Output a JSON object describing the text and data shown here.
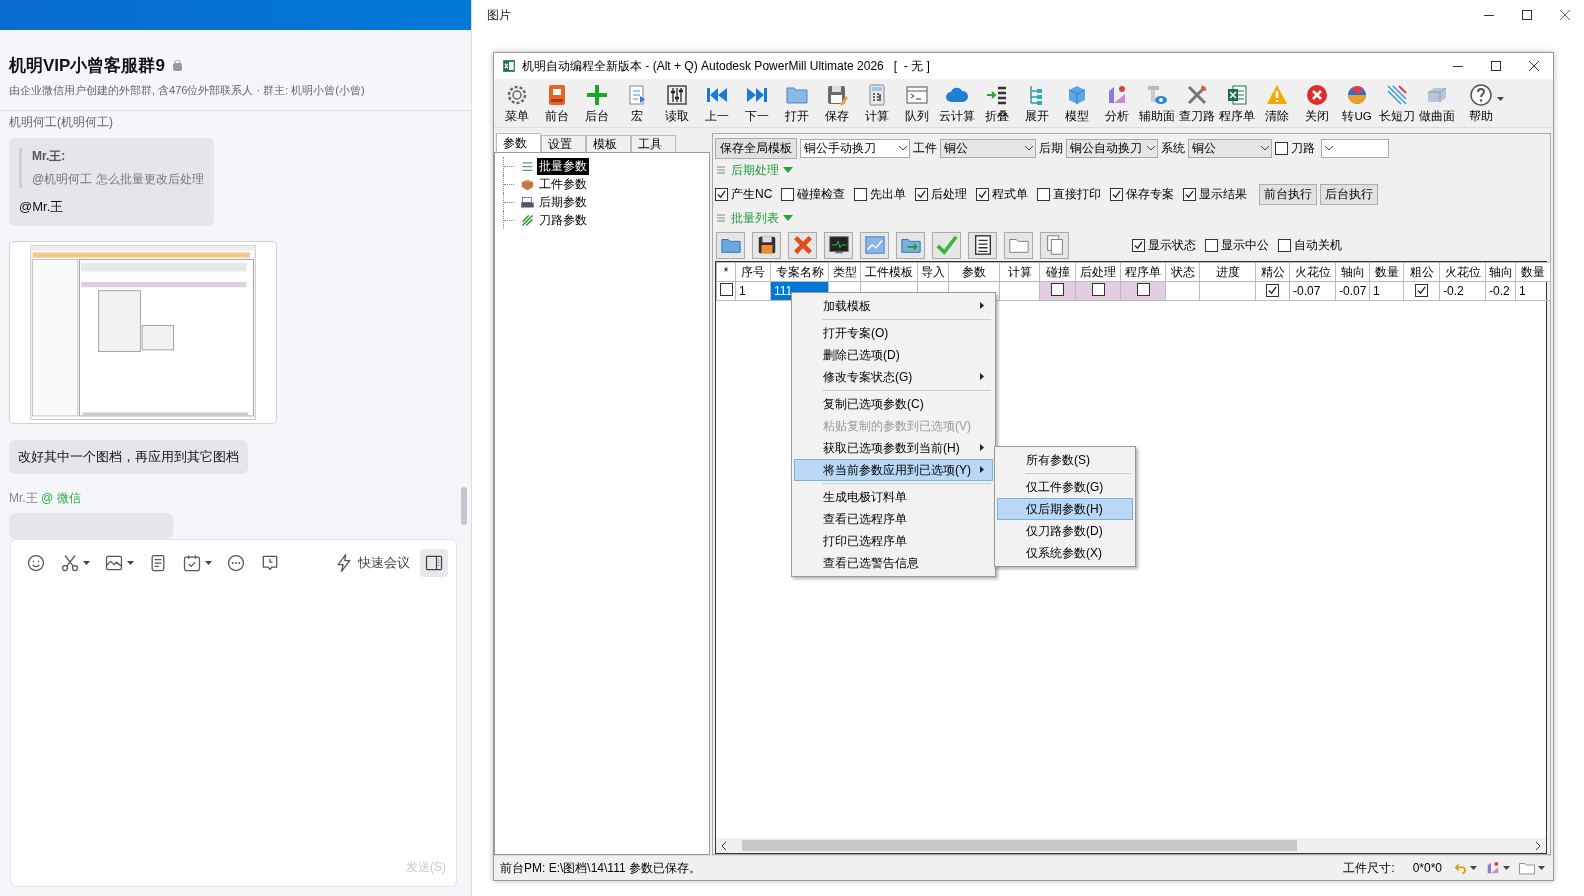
{
  "chat": {
    "title": "机明VIP小曾客服群9",
    "subtitle": "由企业微信用户创建的外部群, 含476位外部联系人 · 群主: 机明小曾(小曾)",
    "sender": "机明何工(机明何工)",
    "quote_author": "Mr.王:",
    "quote_text": "@机明何工 怎么批量更改后处理",
    "reply": "@Mr.王",
    "message": "改好其中一个图档，再应用到其它图档",
    "next_sender": "Mr.王",
    "next_source": "@ 微信",
    "meeting": "快速会议",
    "send": "发送(S)"
  },
  "viewer": {
    "title": "图片"
  },
  "app": {
    "title": "机明自动编程全新版本 - (Alt + Q) Autodesk PowerMill Ultimate 2026   [  - 无 ]",
    "toolbar": [
      "菜单",
      "前台",
      "后台",
      "宏",
      "读取",
      "上一",
      "下一",
      "打开",
      "保存",
      "计算",
      "队列",
      "云计算",
      "折叠",
      "展开",
      "模型",
      "分析",
      "辅助面",
      "查刀路",
      "程序单",
      "清除",
      "关闭",
      "转UG",
      "长短刀",
      "做曲面",
      "帮助"
    ],
    "tabs": [
      {
        "label": "参数",
        "selected": true
      },
      {
        "label": "设置",
        "selected": false
      },
      {
        "label": "模板",
        "selected": false
      },
      {
        "label": "工具",
        "selected": false
      }
    ],
    "tree": [
      {
        "label": "批量参数",
        "selected": true
      },
      {
        "label": "工件参数",
        "selected": false
      },
      {
        "label": "后期参数",
        "selected": false
      },
      {
        "label": "刀路参数",
        "selected": false
      }
    ],
    "save_template": "保存全局模板",
    "template": "铜公手动换刀",
    "work_label": "工件",
    "work": "铜公",
    "post_label": "后期",
    "post": "铜公自动换刀",
    "system_label": "系统",
    "system": "铜公",
    "toolpath": {
      "label": "刀路",
      "checked": false
    },
    "post_section": "后期处理",
    "post_options": [
      {
        "label": "产生NC",
        "checked": true
      },
      {
        "label": "碰撞检查",
        "checked": false
      },
      {
        "label": "先出单",
        "checked": false
      },
      {
        "label": "后处理",
        "checked": true
      },
      {
        "label": "程式单",
        "checked": true
      },
      {
        "label": "直接打印",
        "checked": false
      },
      {
        "label": "保存专案",
        "checked": true
      },
      {
        "label": "显示结果",
        "checked": true
      }
    ],
    "run_buttons": [
      "前台执行",
      "后台执行"
    ],
    "batch_section": "批量列表",
    "view_options": [
      {
        "label": "显示状态",
        "checked": true
      },
      {
        "label": "显示中公",
        "checked": false
      },
      {
        "label": "自动关机",
        "checked": false
      }
    ],
    "table": {
      "columns": [
        "*",
        "序号",
        "专案名称",
        "类型",
        "工件模板",
        "导入",
        "参数",
        "计算",
        "碰撞",
        "后处理",
        "程序单",
        "状态",
        "进度",
        "精公",
        "火花位",
        "轴向",
        "数量",
        "粗公",
        "火花位",
        "轴向",
        "数量"
      ],
      "rows": [
        {
          "cells": [
            {
              "kind": "check",
              "checked": false
            },
            {
              "kind": "text",
              "text": "1"
            },
            {
              "kind": "text",
              "text": "111",
              "selected": true
            },
            {
              "kind": "empty"
            },
            {
              "kind": "empty"
            },
            {
              "kind": "empty"
            },
            {
              "kind": "empty"
            },
            {
              "kind": "empty"
            },
            {
              "kind": "check",
              "checked": false,
              "highlight": true
            },
            {
              "kind": "check",
              "checked": false,
              "highlight": true
            },
            {
              "kind": "check",
              "checked": false,
              "highlight": true
            },
            {
              "kind": "empty"
            },
            {
              "kind": "empty"
            },
            {
              "kind": "check",
              "checked": true
            },
            {
              "kind": "text",
              "text": "-0.07"
            },
            {
              "kind": "text",
              "text": "-0.07"
            },
            {
              "kind": "text",
              "text": "1"
            },
            {
              "kind": "check",
              "checked": true
            },
            {
              "kind": "text",
              "text": "-0.2"
            },
            {
              "kind": "text",
              "text": "-0.2"
            },
            {
              "kind": "text",
              "text": "1"
            }
          ]
        }
      ]
    },
    "menu": [
      {
        "kind": "item",
        "label": "加载模板",
        "submenu": true,
        "disabled": false,
        "selected": false
      },
      {
        "kind": "separator"
      },
      {
        "kind": "item",
        "label": "打开专案(O)",
        "submenu": false,
        "disabled": false,
        "selected": false
      },
      {
        "kind": "item",
        "label": "删除已选项(D)",
        "submenu": false,
        "disabled": false,
        "selected": false
      },
      {
        "kind": "item",
        "label": "修改专案状态(G)",
        "submenu": true,
        "disabled": false,
        "selected": false
      },
      {
        "kind": "separator"
      },
      {
        "kind": "item",
        "label": "复制已选项参数(C)",
        "submenu": false,
        "disabled": false,
        "selected": false
      },
      {
        "kind": "item",
        "label": "粘贴复制的参数到已选项(V)",
        "submenu": false,
        "disabled": true,
        "selected": false
      },
      {
        "kind": "item",
        "label": "获取已选项参数到当前(H)",
        "submenu": true,
        "disabled": false,
        "selected": false
      },
      {
        "kind": "item",
        "label": "将当前参数应用到已选项(Y)",
        "submenu": true,
        "disabled": false,
        "selected": true
      },
      {
        "kind": "separator"
      },
      {
        "kind": "item",
        "label": "生成电极订料单",
        "submenu": false,
        "disabled": false,
        "selected": false
      },
      {
        "kind": "item",
        "label": "查看已选程序单",
        "submenu": false,
        "disabled": false,
        "selected": false
      },
      {
        "kind": "item",
        "label": "打印已选程序单",
        "submenu": false,
        "disabled": false,
        "selected": false
      },
      {
        "kind": "item",
        "label": "查看已选警告信息",
        "submenu": false,
        "disabled": false,
        "selected": false
      }
    ],
    "submenu": [
      {
        "kind": "item",
        "label": "所有参数(S)",
        "selected": false
      },
      {
        "kind": "separator"
      },
      {
        "kind": "item",
        "label": "仅工件参数(G)",
        "selected": false
      },
      {
        "kind": "item",
        "label": "仅后期参数(H)",
        "selected": true
      },
      {
        "kind": "item",
        "label": "仅刀路参数(D)",
        "selected": false
      },
      {
        "kind": "item",
        "label": "仅系统参数(X)",
        "selected": false
      }
    ],
    "status": "前台PM: E:\\图档\\14\\111 参数已保存。",
    "size_label": "工件尺寸:",
    "size": "0*0*0"
  }
}
